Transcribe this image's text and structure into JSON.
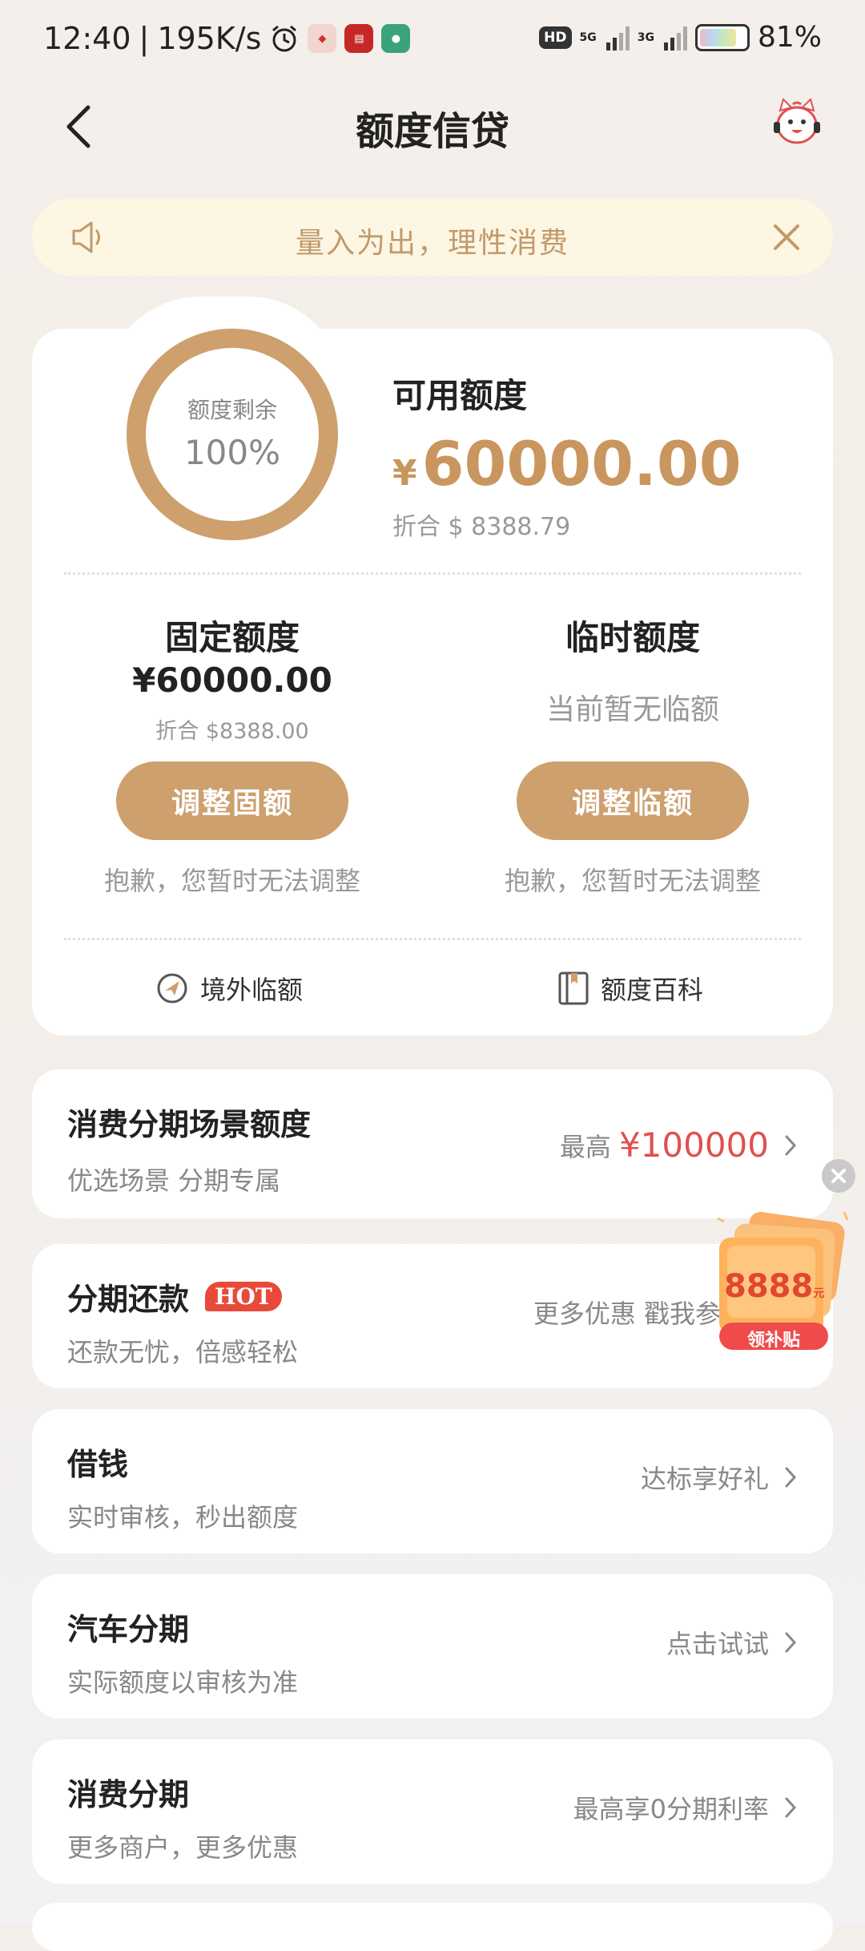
{
  "status_bar": {
    "time": "12:40",
    "speed": "195K/s",
    "net1": "5G",
    "net2": "3G",
    "battery": "81%",
    "battery_level": 0.81,
    "hd": "HD"
  },
  "header": {
    "title": "额度信贷"
  },
  "notice": {
    "text": "量入为出，理性消费"
  },
  "summary": {
    "ring_label": "额度剩余",
    "ring_value": "100%",
    "ring_fraction": 1.0,
    "available_label": "可用额度",
    "available_currency": "¥",
    "available_amount": "60000.00",
    "available_usd": "折合 $ 8388.79"
  },
  "fixed": {
    "title": "固定额度",
    "amount": "¥60000.00",
    "usd": "折合 $8388.00",
    "button": "调整固额",
    "note": "抱歉，您暂时无法调整"
  },
  "temp": {
    "title": "临时额度",
    "status": "当前暂无临额",
    "button": "调整临额",
    "note": "抱歉，您暂时无法调整"
  },
  "links": {
    "overseas": "境外临额",
    "wiki": "额度百科"
  },
  "list": [
    {
      "title": "消费分期场景额度",
      "subtitle": "优选场景 分期专属",
      "right_prefix": "最高",
      "right_value": "¥100000"
    },
    {
      "title": "分期还款",
      "badge": "HOT",
      "subtitle": "还款无忧，倍感轻松",
      "right": "更多优惠 戳我参"
    },
    {
      "title": "借钱",
      "subtitle": "实时审核，秒出额度",
      "right": "达标享好礼"
    },
    {
      "title": "汽车分期",
      "subtitle": "实际额度以审核为准",
      "right": "点击试试"
    },
    {
      "title": "消费分期",
      "subtitle": "更多商户，更多优惠",
      "right": "最高享0分期利率"
    }
  ],
  "promo": {
    "amount": "8888",
    "unit": "元",
    "label": "领补贴"
  },
  "colors": {
    "accent": "#cda06e",
    "accent_text": "#c8965e",
    "hot": "#e84a3a",
    "highlight_red": "#e05050",
    "notice_bg": "#fdf6e3"
  }
}
